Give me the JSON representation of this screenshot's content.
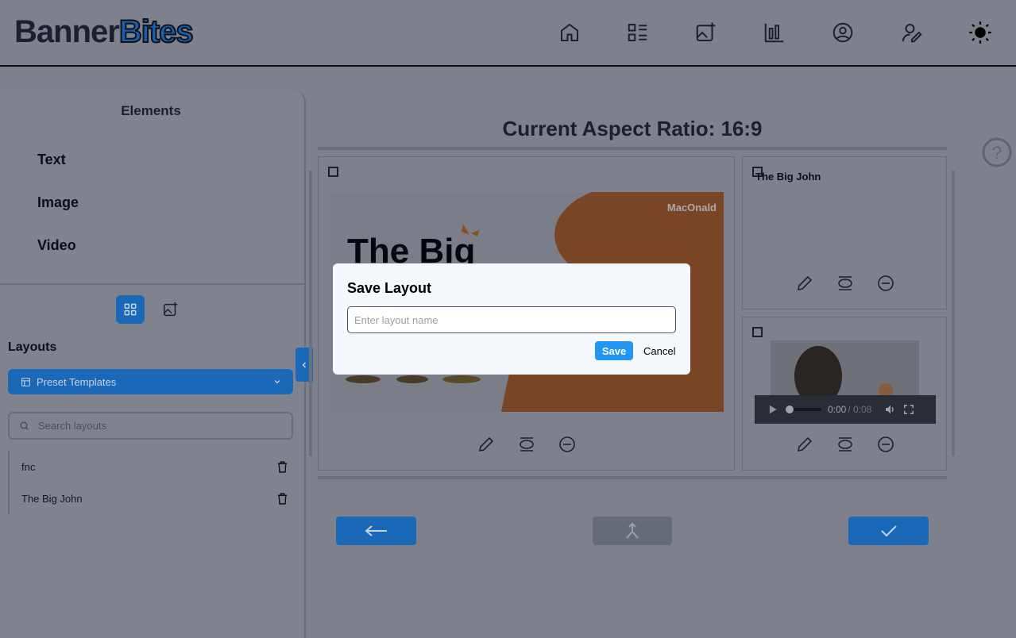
{
  "app": {
    "logo_part1": "Banner",
    "logo_part2": "Bites"
  },
  "nav": [
    "home-icon",
    "list-icon",
    "image-add-icon",
    "chart-icon",
    "user-circle-icon",
    "user-edit-icon",
    "sun-icon"
  ],
  "sidebar": {
    "elements_title": "Elements",
    "elements": [
      "Text",
      "Image",
      "Video"
    ],
    "layouts_title": "Layouts",
    "preset_label": "Preset Templates",
    "search_placeholder": "Search layouts",
    "layouts": [
      "fnc",
      "The Big John"
    ]
  },
  "main": {
    "aspect_title": "Current Aspect Ratio: 16:9",
    "banner": {
      "brand": "MacOnald",
      "headline": "The Big"
    },
    "text_card": "The Big John",
    "video": {
      "current": "0:00",
      "duration": "/ 0:08"
    }
  },
  "modal": {
    "title": "Save Layout",
    "placeholder": "Enter layout name",
    "save": "Save",
    "cancel": "Cancel"
  },
  "colors": {
    "accent": "#2196f3",
    "overlay": "#7e818b",
    "banner_orange": "#7a4525"
  }
}
